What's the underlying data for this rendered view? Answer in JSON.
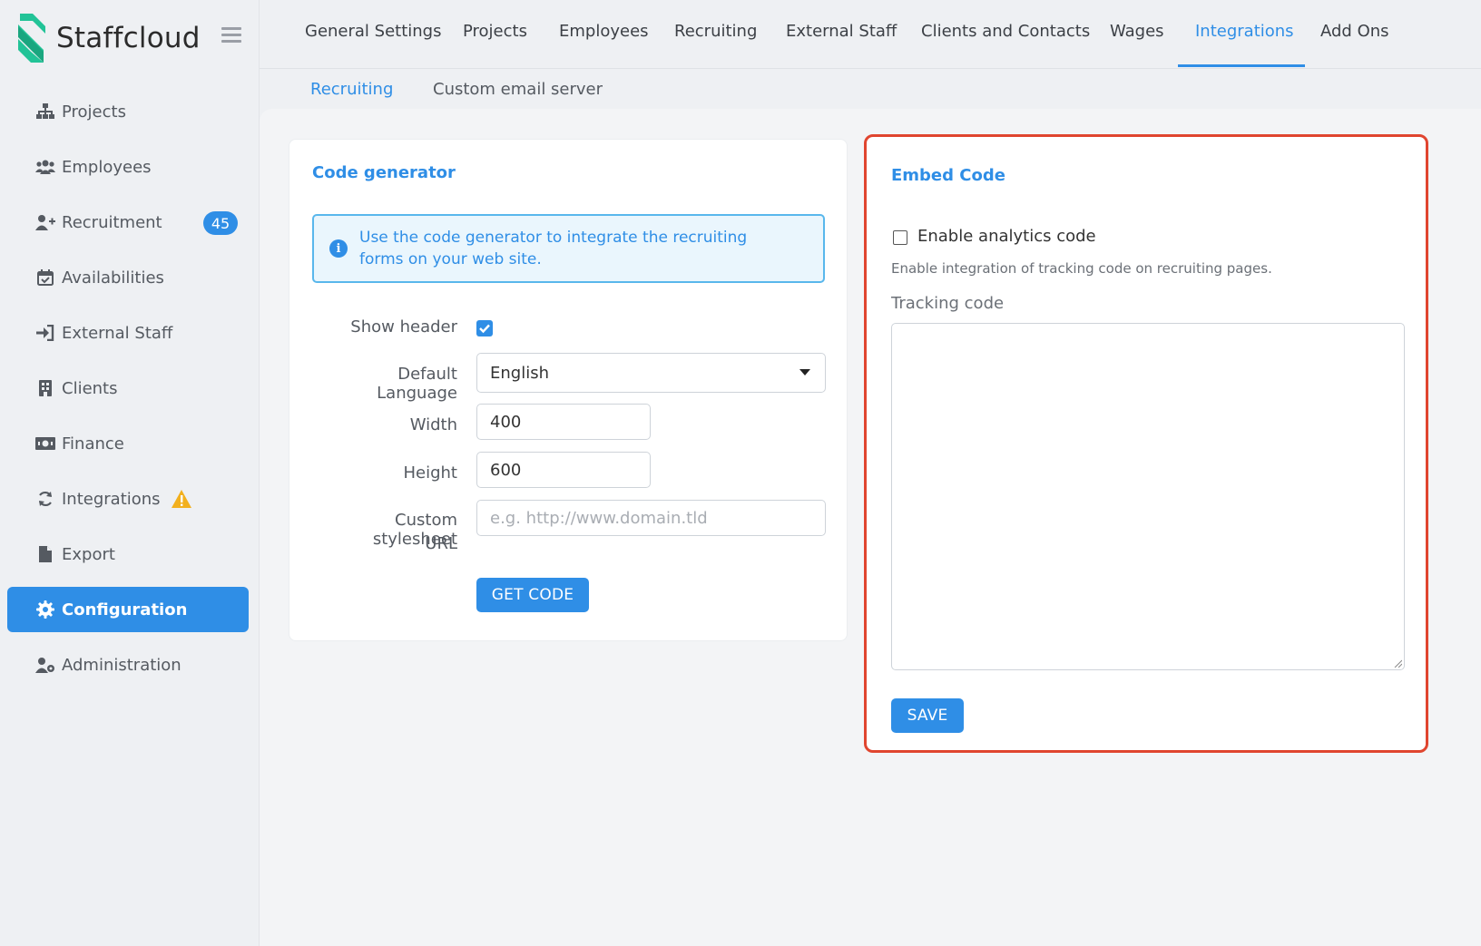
{
  "brand": {
    "name": "Staffcloud"
  },
  "colors": {
    "accent": "#2f8ee6",
    "highlight": "#e0452f",
    "logo": "#22c397",
    "warning": "#f2b01e"
  },
  "sidebar": {
    "items": [
      {
        "label": "Projects",
        "icon": "sitemap-icon"
      },
      {
        "label": "Employees",
        "icon": "users-icon"
      },
      {
        "label": "Recruitment",
        "icon": "user-plus-icon",
        "badge": "45"
      },
      {
        "label": "Availabilities",
        "icon": "calendar-check-icon"
      },
      {
        "label": "External Staff",
        "icon": "sign-in-icon"
      },
      {
        "label": "Clients",
        "icon": "building-icon"
      },
      {
        "label": "Finance",
        "icon": "money-bill-icon"
      },
      {
        "label": "Integrations",
        "icon": "sync-icon",
        "warning": true
      },
      {
        "label": "Export",
        "icon": "file-icon"
      },
      {
        "label": "Configuration",
        "icon": "cog-icon",
        "active": true
      },
      {
        "label": "Administration",
        "icon": "user-cog-icon"
      }
    ]
  },
  "topnav": {
    "tabs": [
      {
        "label": "General Settings"
      },
      {
        "label": "Projects"
      },
      {
        "label": "Employees"
      },
      {
        "label": "Recruiting"
      },
      {
        "label": "External Staff"
      },
      {
        "label": "Clients and Contacts"
      },
      {
        "label": "Wages"
      },
      {
        "label": "Integrations",
        "active": true
      },
      {
        "label": "Add Ons"
      }
    ]
  },
  "subnav": {
    "tabs": [
      {
        "label": "Recruiting",
        "active": true
      },
      {
        "label": "Custom email server"
      }
    ]
  },
  "code_generator": {
    "title": "Code generator",
    "info": "Use the code generator to integrate the recruiting forms on your web site.",
    "show_header_label": "Show header",
    "show_header_checked": true,
    "language_label": "Default Language",
    "language_value": "English",
    "width_label": "Width",
    "width_value": "400",
    "height_label": "Height",
    "height_value": "600",
    "stylesheet_label_line1": "Custom stylesheet",
    "stylesheet_label_line2": "URL",
    "stylesheet_placeholder": "e.g. http://www.domain.tld",
    "get_code_label": "GET CODE"
  },
  "embed_code": {
    "title": "Embed Code",
    "analytics_label": "Enable analytics code",
    "analytics_checked": false,
    "analytics_hint": "Enable integration of tracking code on recruiting pages.",
    "tracking_label": "Tracking code",
    "tracking_value": "",
    "save_label": "SAVE"
  }
}
